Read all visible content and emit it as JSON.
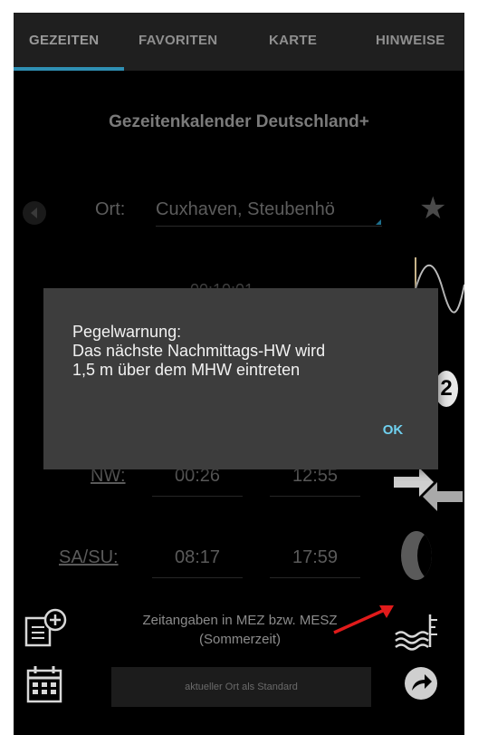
{
  "tabs": [
    "GEZEITEN",
    "FAVORITEN",
    "KARTE",
    "HINWEISE"
  ],
  "title": "Gezeitenkalender Deutschland+",
  "ort": {
    "label": "Ort:",
    "value": "Cuxhaven, Steubenhö"
  },
  "hidden_row": {
    "time": "00:10:01"
  },
  "rows": [
    {
      "label": "NW:",
      "times": [
        "00:26",
        "12:55"
      ]
    },
    {
      "label": "SA/SU:",
      "times": [
        "08:17",
        "17:59"
      ]
    }
  ],
  "badge": "2",
  "note": [
    "Zeitangaben in MEZ bzw. MESZ",
    "(Sommerzeit)"
  ],
  "standard_button": "aktueller Ort als Standard",
  "dialog": {
    "lines": [
      "Pegelwarnung:",
      "Das nächste Nachmittags-HW wird",
      "1,5 m über dem MHW eintreten"
    ],
    "ok": "OK"
  },
  "colors": {
    "accent": "#2f8fb3",
    "ok_text": "#6fd0ef",
    "annotation_arrow": "#e11b1b"
  },
  "icons": [
    "back-icon",
    "star-icon",
    "tide-curve-icon",
    "arrows-icon",
    "moon-icon",
    "add-document-icon",
    "calendar-icon",
    "water-level-icon",
    "share-icon"
  ]
}
